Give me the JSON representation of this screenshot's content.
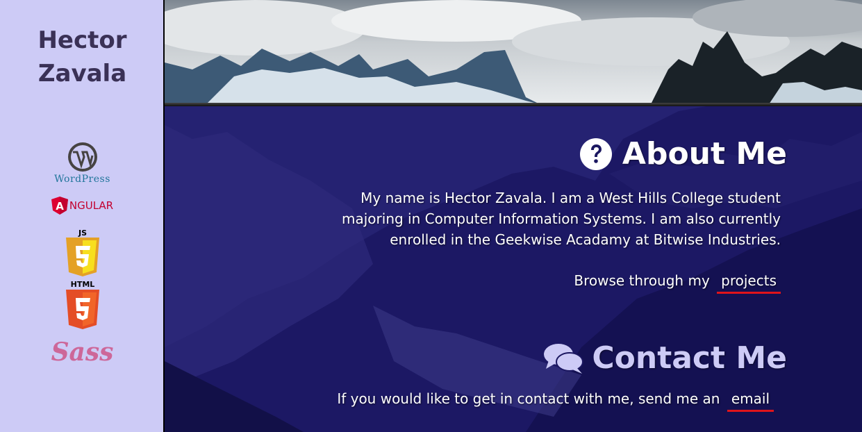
{
  "sidebar": {
    "name_first": "Hector",
    "name_last": "Zavala",
    "logos": {
      "wordpress": "WordPress",
      "angular": "NGULAR",
      "angular_letter": "A",
      "js": "JS",
      "html": "HTML",
      "sass": "Sass"
    }
  },
  "about": {
    "title": "About Me",
    "icon": "question-circle-icon",
    "text": "My name is Hector Zavala. I am a West Hills College student majoring in Computer Information Systems. I am also currently enrolled in the Geekwise Acadamy at Bitwise Industries.",
    "browse_prefix": "Browse through my",
    "projects_link": "projects"
  },
  "contact": {
    "title": "Contact Me",
    "icon": "comments-icon",
    "text_prefix": "If you would like to get in contact with me, send me an",
    "email_link": "email"
  },
  "colors": {
    "sidebar_bg": "#cdcbf6",
    "overlay": "#1b1760",
    "link_underline": "#e0141a",
    "name": "#3a3156"
  }
}
